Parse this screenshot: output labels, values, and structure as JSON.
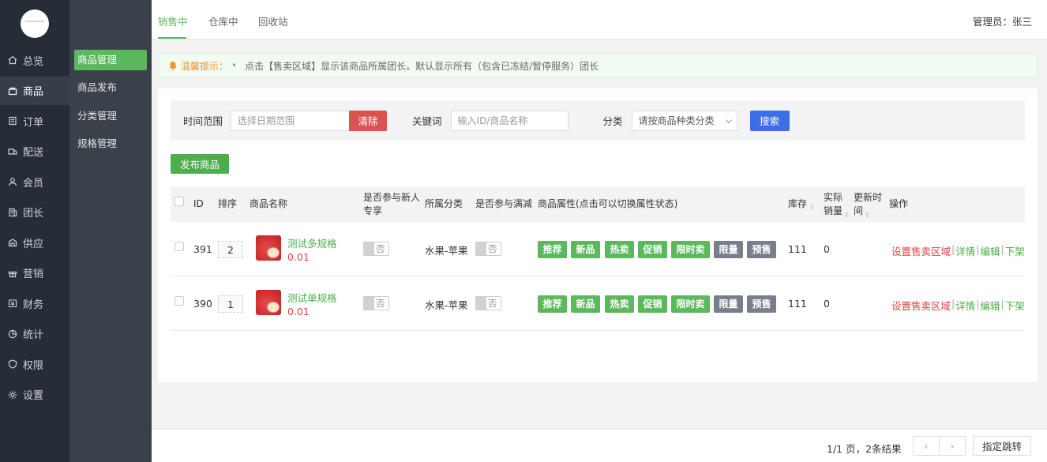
{
  "sidebar": {
    "items": [
      {
        "label": "总览",
        "icon": "home-icon"
      },
      {
        "label": "商品",
        "icon": "shop-icon"
      },
      {
        "label": "订单",
        "icon": "order-icon"
      },
      {
        "label": "配送",
        "icon": "delivery-icon"
      },
      {
        "label": "会员",
        "icon": "user-icon"
      },
      {
        "label": "团长",
        "icon": "leader-icon"
      },
      {
        "label": "供应",
        "icon": "supply-icon"
      },
      {
        "label": "营销",
        "icon": "gift-icon"
      },
      {
        "label": "财务",
        "icon": "finance-icon"
      },
      {
        "label": "统计",
        "icon": "chart-icon"
      },
      {
        "label": "权限",
        "icon": "shield-icon"
      },
      {
        "label": "设置",
        "icon": "gear-icon"
      }
    ]
  },
  "submenu": {
    "items": [
      "商品管理",
      "商品发布",
      "分类管理",
      "规格管理"
    ]
  },
  "tabs": [
    "销售中",
    "仓库中",
    "回收站"
  ],
  "admin": "管理员：张三",
  "tip": {
    "label": "温馨提示：",
    "bullet": "•",
    "text": "点击【售卖区域】显示该商品所属团长。默认显示所有（包含已冻结/暂停服务）团长"
  },
  "filter": {
    "time_label": "时间范围",
    "time_placeholder": "选择日期范围",
    "clear": "清除",
    "keyword_label": "关键词",
    "keyword_placeholder": "输入ID/商品名称",
    "category_label": "分类",
    "category_value": "请按商品种类分类",
    "search": "搜索"
  },
  "publish": "发布商品",
  "table": {
    "headers": {
      "id": "ID",
      "sort": "排序",
      "name": "商品名称",
      "newbie1": "是否参与新人",
      "newbie2": "专享",
      "category": "所属分类",
      "discount": "是否参与满减",
      "attrs": "商品属性(点击可以切换属性状态)",
      "stock": "库存",
      "sales1": "实际",
      "sales2": "销量",
      "updated1": "更新时",
      "updated2": "间",
      "ops": "操作"
    },
    "rows": [
      {
        "id": "391",
        "sort": "2",
        "name": "测试多规格",
        "price": "0.01",
        "newbie": "否",
        "category": "水果-苹果",
        "discount": "否",
        "stock": "111",
        "sales": "0"
      },
      {
        "id": "390",
        "sort": "1",
        "name": "测试单规格",
        "price": "0.01",
        "newbie": "否",
        "category": "水果-苹果",
        "discount": "否",
        "stock": "111",
        "sales": "0"
      }
    ],
    "tags": [
      "推荐",
      "新品",
      "热卖",
      "促销",
      "限时卖",
      "限量",
      "预售"
    ],
    "ops": [
      "设置售卖区域",
      "|",
      "详情",
      "|",
      "编辑",
      "|",
      "下架"
    ]
  },
  "footer": {
    "info": "1/1 页，2条结果",
    "goto": "指定跳转"
  },
  "colors": {
    "accent": "#5cb85c",
    "danger": "#e64340",
    "search": "#3d6ee6",
    "warn": "#f0942b"
  }
}
